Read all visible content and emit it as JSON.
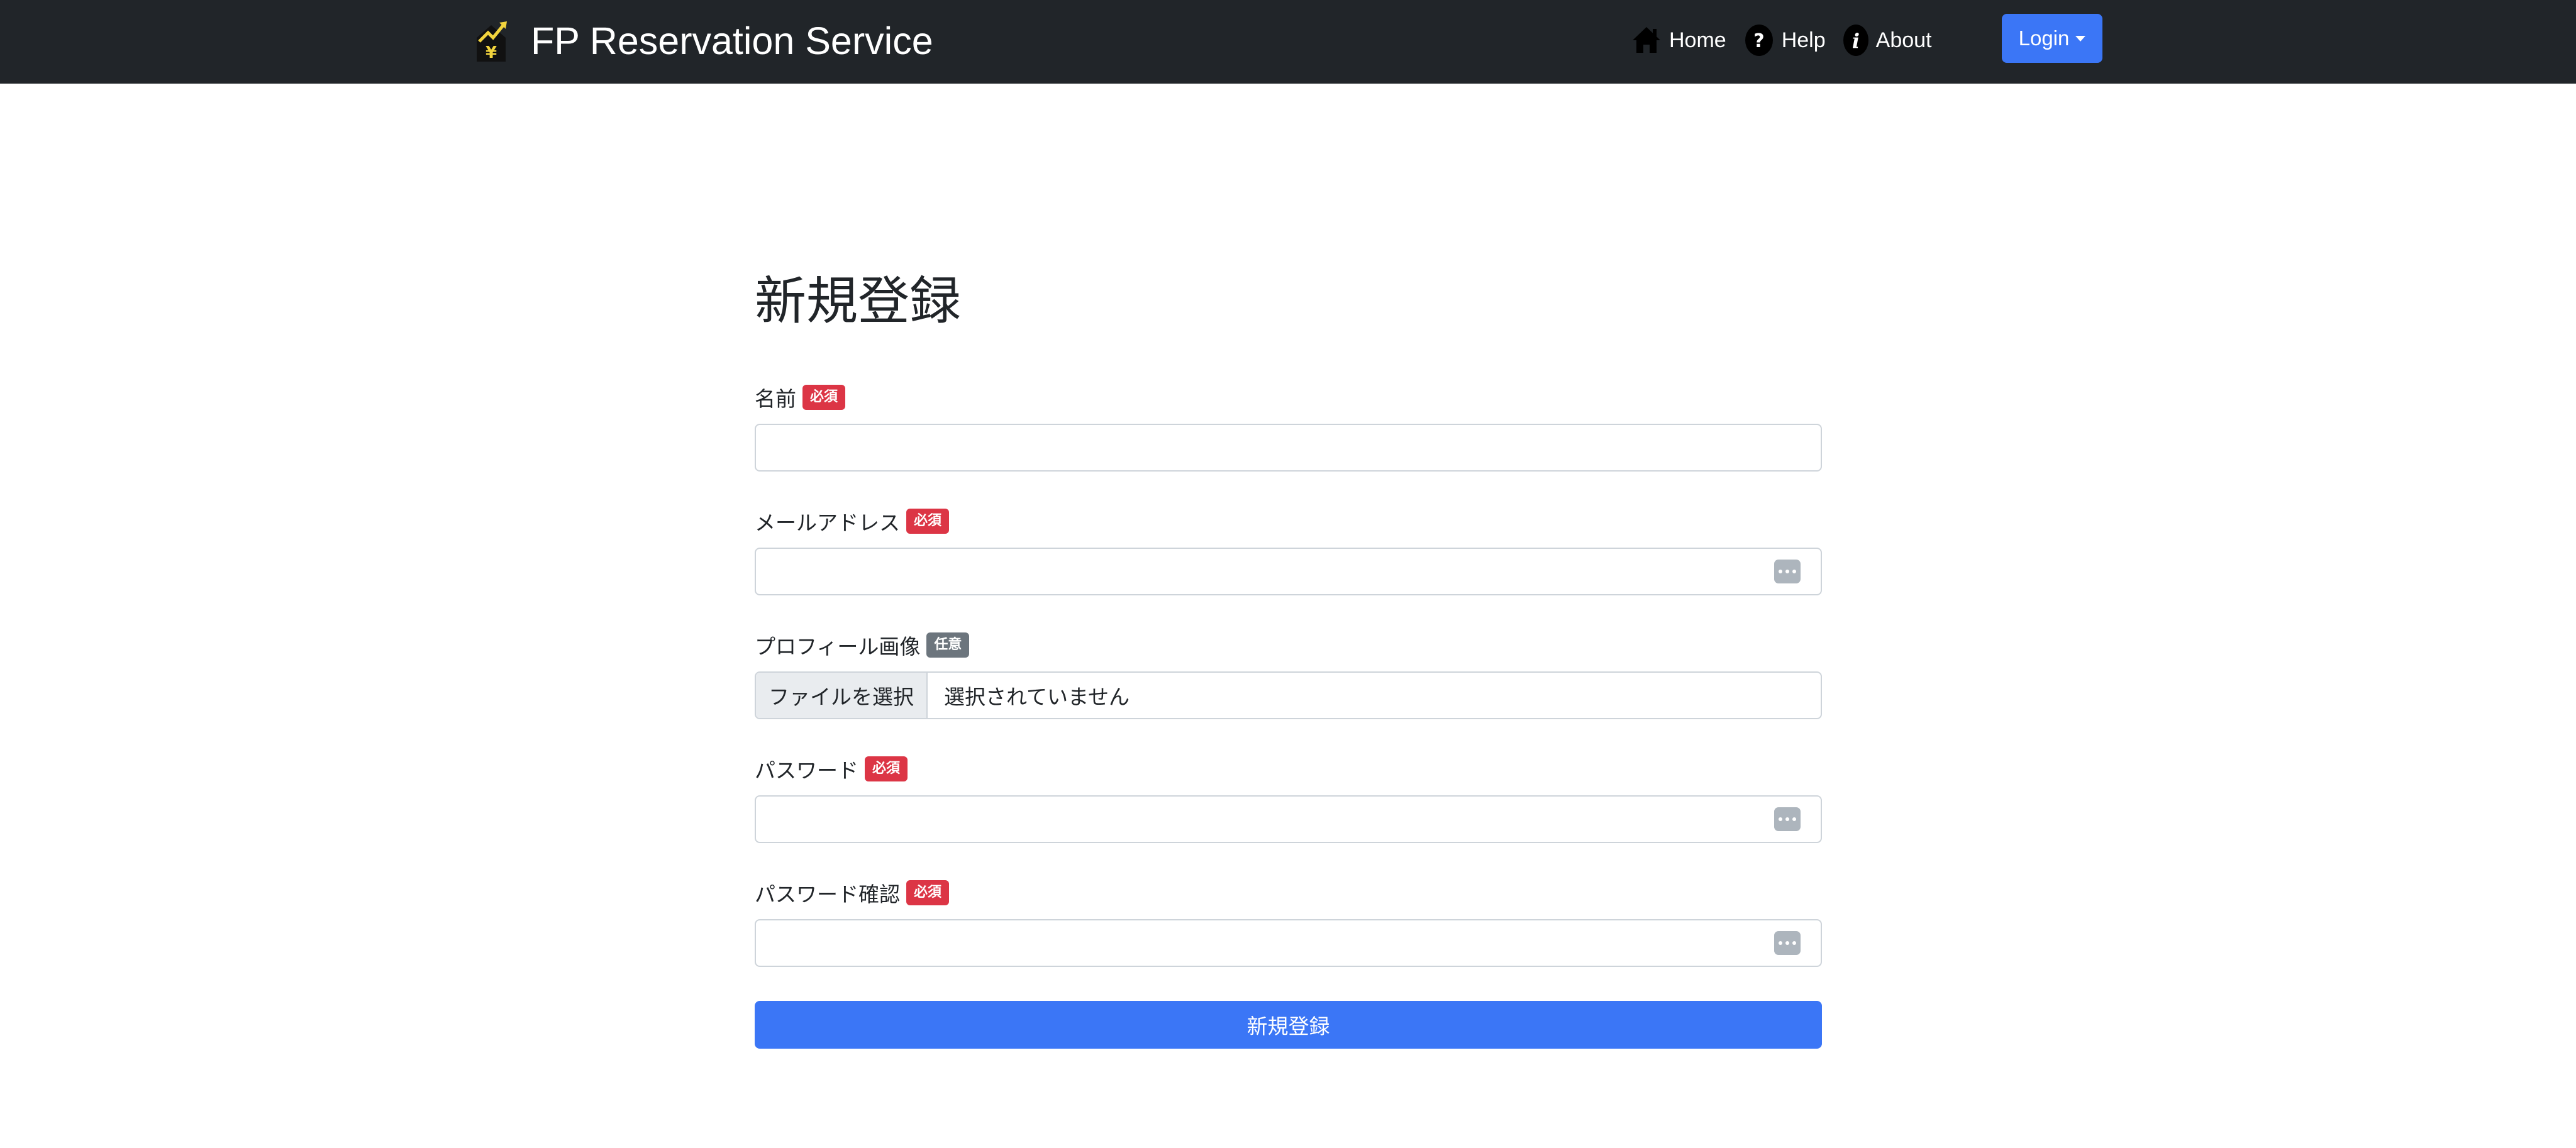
{
  "navbar": {
    "brand_title": "FP Reservation Service",
    "logo_icon": "house-yen-chart-icon",
    "links": [
      {
        "label": "Home",
        "icon": "home-icon"
      },
      {
        "label": "Help",
        "icon": "question-circle-icon"
      },
      {
        "label": "About",
        "icon": "info-circle-icon"
      }
    ],
    "login_label": "Login"
  },
  "form": {
    "title": "新規登録",
    "fields": {
      "name": {
        "label": "名前",
        "badge": "必須",
        "value": ""
      },
      "email": {
        "label": "メールアドレス",
        "badge": "必須",
        "value": ""
      },
      "profile_image": {
        "label": "プロフィール画像",
        "badge": "任意",
        "button_label": "ファイルを選択",
        "status": "選択されていません"
      },
      "password": {
        "label": "パスワード",
        "badge": "必須",
        "value": ""
      },
      "password_confirm": {
        "label": "パスワード確認",
        "badge": "必須",
        "value": ""
      }
    },
    "submit_label": "新規登録"
  },
  "colors": {
    "navbar_bg": "#212529",
    "primary": "#3b76f6",
    "required_badge": "#dc3545",
    "optional_badge": "#6c757d"
  }
}
